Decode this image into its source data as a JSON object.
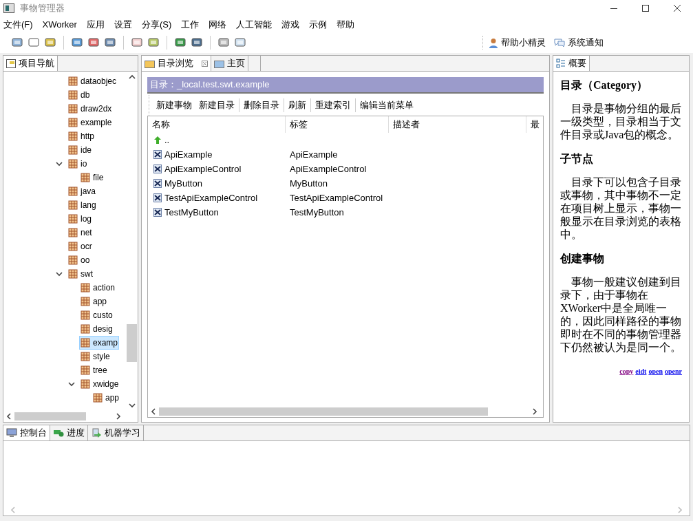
{
  "window": {
    "title": "事物管理器"
  },
  "menu": [
    "文件(F)",
    "XWorker",
    "应用",
    "设置",
    "分享(S)",
    "工作",
    "网络",
    "人工智能",
    "游戏",
    "示例",
    "帮助"
  ],
  "toolbar_right": [
    {
      "label": "帮助小精灵",
      "kind": "person"
    },
    {
      "label": "系统通知",
      "kind": "chat"
    }
  ],
  "navigator": {
    "tab": {
      "label": "项目导航",
      "selected": true
    },
    "tree": [
      {
        "label": "dataobjec",
        "selected": false
      },
      {
        "label": "db",
        "selected": false
      },
      {
        "label": "draw2dx",
        "selected": false
      },
      {
        "label": "example",
        "selected": false
      },
      {
        "label": "http",
        "selected": false
      },
      {
        "label": "ide",
        "selected": false
      },
      {
        "label": "io",
        "selected": false,
        "expanded": true,
        "children": [
          {
            "label": "file",
            "selected": false
          }
        ]
      },
      {
        "label": "java",
        "selected": false
      },
      {
        "label": "lang",
        "selected": false
      },
      {
        "label": "log",
        "selected": false
      },
      {
        "label": "net",
        "selected": false
      },
      {
        "label": "ocr",
        "selected": false
      },
      {
        "label": "oo",
        "selected": false
      },
      {
        "label": "swt",
        "selected": false,
        "expanded": true,
        "children": [
          {
            "label": "action",
            "selected": false
          },
          {
            "label": "app",
            "selected": false
          },
          {
            "label": "custo",
            "selected": false
          },
          {
            "label": "desig",
            "selected": false
          },
          {
            "label": "examp",
            "selected": true
          },
          {
            "label": "style",
            "selected": false
          },
          {
            "label": "tree",
            "selected": false
          },
          {
            "label": "xwidge",
            "selected": false,
            "expanded": true,
            "children": [
              {
                "label": "app",
                "selected": false
              }
            ]
          }
        ]
      }
    ]
  },
  "editor": {
    "tabs": [
      {
        "label": "目录浏览",
        "selected": true,
        "closable": true
      },
      {
        "label": "主页",
        "selected": false,
        "closable": false
      }
    ],
    "path": "目录：_local.test.swt.example",
    "actions": [
      [
        "新建事物",
        "新建目录"
      ],
      [
        "删除目录"
      ],
      [
        "刷新"
      ],
      [
        "重建索引"
      ],
      [
        "编辑当前菜单"
      ]
    ],
    "table": {
      "columns": [
        "名称",
        "标签",
        "描述者",
        "最"
      ],
      "rows": [
        {
          "kind": "parent",
          "name": ".."
        },
        {
          "kind": "thing",
          "name": "ApiExample",
          "label": "ApiExample"
        },
        {
          "kind": "thing",
          "name": "ApiExampleControl",
          "label": "ApiExampleControl"
        },
        {
          "kind": "thing",
          "name": "MyButton",
          "label": "MyButton"
        },
        {
          "kind": "thing",
          "name": "TestApiExampleControl",
          "label": "TestApiExampleControl"
        },
        {
          "kind": "thing",
          "name": "TestMyButton",
          "label": "TestMyButton"
        }
      ]
    }
  },
  "outline": {
    "tab": {
      "label": "概要",
      "selected": true
    },
    "sections": [
      {
        "heading": "目录（Category）",
        "text": "目录是事物分组的最后一级类型，目录相当于文件目录或Java包的概念。"
      },
      {
        "heading": "子节点",
        "text": "目录下可以包含子目录或事物，其中事物不一定在项目树上显示，事物一般显示在目录浏览的表格中。"
      },
      {
        "heading": "创建事物",
        "text": "事物一般建议创建到目录下，由于事物在XWorker中是全局唯一的，因此同样路径的事物即时在不同的事物管理器下仍然被认为是同一个。"
      }
    ],
    "links": [
      "copy",
      "eidt",
      "open",
      "openr"
    ]
  },
  "console": {
    "tabs": [
      {
        "label": "控制台",
        "selected": true,
        "kind": "console"
      },
      {
        "label": "进度",
        "selected": false,
        "kind": "progress"
      },
      {
        "label": "机器学习",
        "selected": false,
        "kind": "learning"
      }
    ]
  }
}
